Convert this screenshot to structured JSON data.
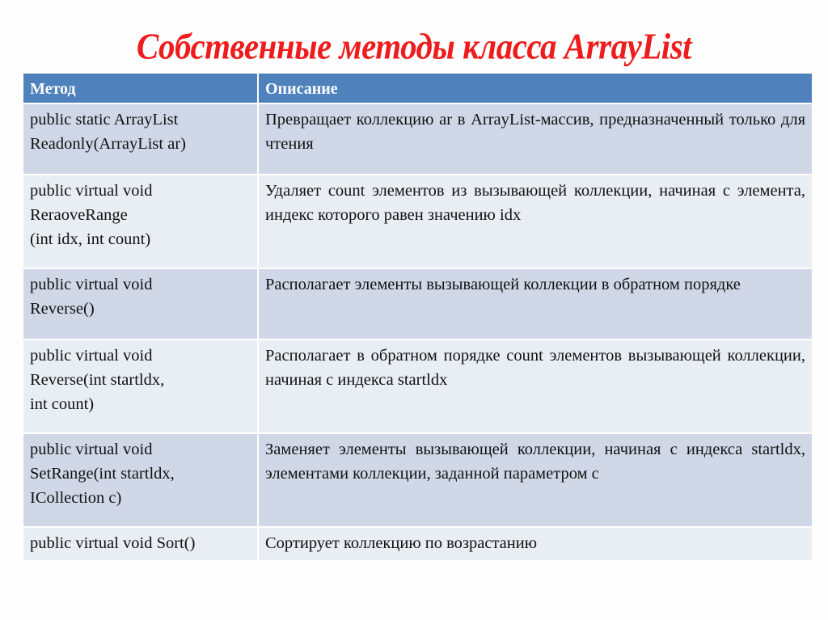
{
  "slide": {
    "title": "Собственные методы класса ArrayList"
  },
  "table": {
    "headers": {
      "method": "Метод",
      "description": "Описание"
    },
    "rows": [
      {
        "method_lines": [
          "public static ArrayList",
          "Readonly(ArrayList ar)"
        ],
        "description": "Превращает коллекцию ar в ArrayList-массив, предназначенный только для чтения"
      },
      {
        "method_lines": [
          "public virtual void",
          "ReraoveRange",
          "(int idx, int count)"
        ],
        "description": "Удаляет count элементов из вызывающей коллекции, начиная с элемента, индекс которого равен значению idx"
      },
      {
        "method_lines": [
          "public virtual void",
          "Reverse()"
        ],
        "description": "Располагает элементы вызывающей коллекции в обратном порядке"
      },
      {
        "method_lines": [
          "public virtual void",
          "Reverse(int startldx,",
          "int count)"
        ],
        "description": "Располагает в обратном порядке count элементов вызывающей коллекции, начиная с индекса startldx"
      },
      {
        "method_lines": [
          "public virtual void",
          "SetRange(int startldx,",
          "ICollection c)"
        ],
        "description": "Заменяет элементы вызывающей коллекции, начиная с индекса startldx, элементами коллекции, заданной параметром с"
      },
      {
        "method_lines": [
          "public virtual void Sort()"
        ],
        "description": "Сортирует коллекцию по возрастанию"
      }
    ]
  },
  "colors": {
    "title": "#ee1c1c",
    "header_bg": "#4f81bd",
    "row_odd_bg": "#d0d8e8",
    "row_even_bg": "#e9edf4"
  }
}
